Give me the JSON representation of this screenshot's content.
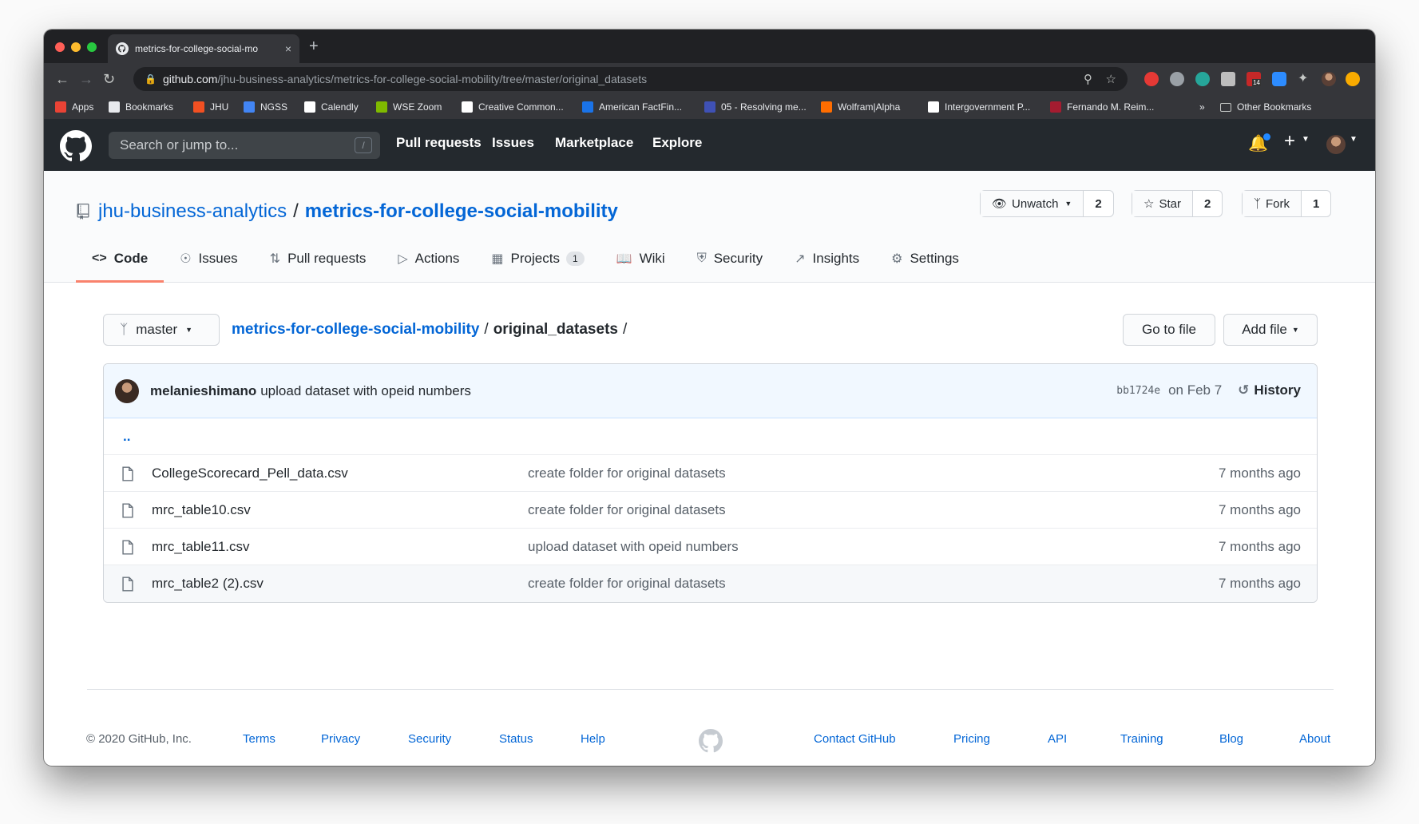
{
  "browser": {
    "tab_title": "metrics-for-college-social-mo",
    "tab_close": "×",
    "new_tab": "+",
    "url_host": "github.com",
    "url_path": "/jhu-business-analytics/metrics-for-college-social-mobility/tree/master/original_datasets",
    "ext_badge": "14",
    "bookmarks": [
      {
        "label": "Apps",
        "icon": "apps-grid-icon",
        "color": "#ea4335"
      },
      {
        "label": "Bookmarks",
        "icon": "star-icon",
        "color": "#e8eaed"
      },
      {
        "label": "JHU",
        "icon": "microsoft-icon",
        "color": "#f25022"
      },
      {
        "label": "NGSS",
        "icon": "ngss-icon",
        "color": "#4285f4"
      },
      {
        "label": "Calendly",
        "icon": "calendly-icon",
        "color": "#ffffff"
      },
      {
        "label": "WSE Zoom",
        "icon": "microsoft-icon",
        "color": "#7fba00"
      },
      {
        "label": "Creative Common...",
        "icon": "cc-icon",
        "color": "#ffffff"
      },
      {
        "label": "American FactFin...",
        "icon": "bar-chart-icon",
        "color": "#1a73e8"
      },
      {
        "label": "05 - Resolving me...",
        "icon": "shield-icon",
        "color": "#3f51b5"
      },
      {
        "label": "Wolfram|Alpha",
        "icon": "wolfram-icon",
        "color": "#ff6d00"
      },
      {
        "label": "Intergovernment P...",
        "icon": "eagle-icon",
        "color": "#ffffff"
      },
      {
        "label": "Fernando M. Reim...",
        "icon": "harvard-icon",
        "color": "#a51c30"
      }
    ],
    "bookmarks_more": "»",
    "other_bookmarks": "Other Bookmarks"
  },
  "github": {
    "search_placeholder": "Search or jump to...",
    "search_key": "/",
    "nav": [
      "Pull requests",
      "Issues",
      "Marketplace",
      "Explore"
    ],
    "header_bg": "#24292e"
  },
  "repo": {
    "owner": "jhu-business-analytics",
    "separator": "/",
    "name": "metrics-for-college-social-mobility",
    "watch_label": "Unwatch",
    "watch_count": "2",
    "star_label": "Star",
    "star_count": "2",
    "fork_label": "Fork",
    "fork_count": "1",
    "tabs": [
      {
        "label": "Code",
        "icon": "code-icon"
      },
      {
        "label": "Issues",
        "icon": "issue-icon"
      },
      {
        "label": "Pull requests",
        "icon": "pull-request-icon"
      },
      {
        "label": "Actions",
        "icon": "play-icon"
      },
      {
        "label": "Projects",
        "icon": "project-icon",
        "badge": "1"
      },
      {
        "label": "Wiki",
        "icon": "book-icon"
      },
      {
        "label": "Security",
        "icon": "shield-icon"
      },
      {
        "label": "Insights",
        "icon": "graph-icon"
      },
      {
        "label": "Settings",
        "icon": "gear-icon"
      }
    ],
    "active_tab_color": "#f9826c"
  },
  "filenav": {
    "branch": "master",
    "crumb_repo": "metrics-for-college-social-mobility",
    "crumb_sep": "/",
    "crumb_dir": "original_datasets",
    "crumb_trail": "/",
    "go_to_file": "Go to file",
    "add_file": "Add file"
  },
  "commit": {
    "author": "melanieshimano",
    "message": "upload dataset with opeid numbers",
    "sha": "bb1724e",
    "date": "on Feb 7",
    "history": "History"
  },
  "files": {
    "updir": "..",
    "rows": [
      {
        "name": "CollegeScorecard_Pell_data.csv",
        "message": "create folder for original datasets",
        "age": "7 months ago"
      },
      {
        "name": "mrc_table10.csv",
        "message": "create folder for original datasets",
        "age": "7 months ago"
      },
      {
        "name": "mrc_table11.csv",
        "message": "upload dataset with opeid numbers",
        "age": "7 months ago"
      },
      {
        "name": "mrc_table2 (2).csv",
        "message": "create folder for original datasets",
        "age": "7 months ago"
      }
    ]
  },
  "footer": {
    "copyright": "© 2020 GitHub, Inc.",
    "left_links": [
      "Terms",
      "Privacy",
      "Security",
      "Status",
      "Help"
    ],
    "right_links": [
      "Contact GitHub",
      "Pricing",
      "API",
      "Training",
      "Blog",
      "About"
    ]
  }
}
